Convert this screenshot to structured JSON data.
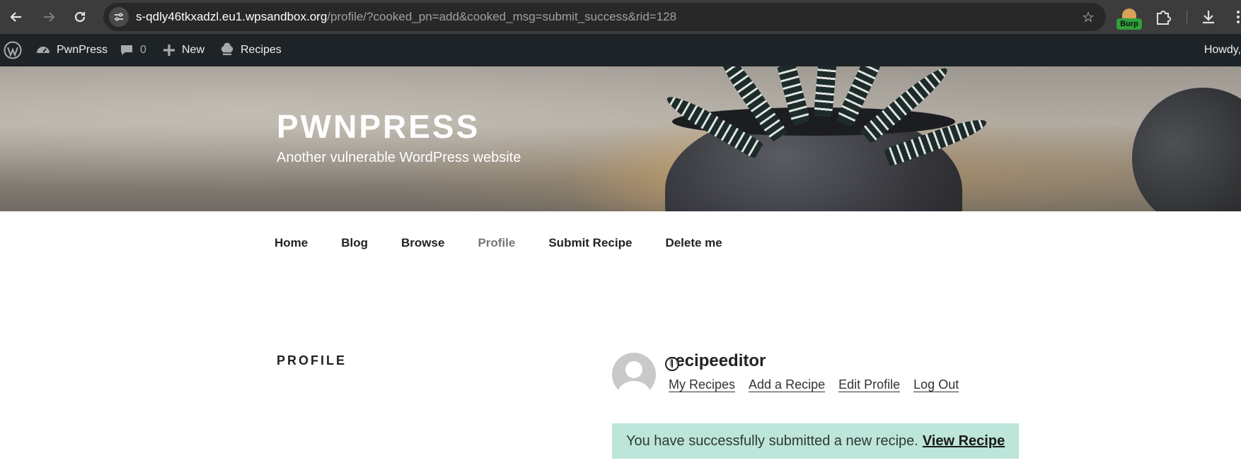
{
  "browser": {
    "url_host": "s-qdly46tkxadzl.eu1.wpsandbox.org",
    "url_rest": "/profile/?cooked_pn=add&cooked_msg=submit_success&rid=128",
    "extension_badge": "Burp",
    "icons": [
      "back-arrow-icon",
      "forward-arrow-icon",
      "reload-icon",
      "site-info-icon",
      "bookmark-star-icon",
      "burp-extension-icon",
      "extensions-puzzle-icon",
      "download-icon"
    ]
  },
  "adminbar": {
    "site_name": "PwnPress",
    "comments_count": "0",
    "new_label": "New",
    "recipes_label": "Recipes",
    "howdy": "Howdy,"
  },
  "header": {
    "site_title": "PWNPRESS",
    "tagline": "Another vulnerable WordPress website"
  },
  "nav": {
    "items": [
      {
        "label": "Home"
      },
      {
        "label": "Blog"
      },
      {
        "label": "Browse"
      },
      {
        "label": "Profile"
      },
      {
        "label": "Submit Recipe"
      },
      {
        "label": "Delete me"
      }
    ],
    "current": "Profile"
  },
  "content": {
    "heading": "PROFILE",
    "username": "recipeeditor",
    "links": [
      {
        "label": "My Recipes"
      },
      {
        "label": "Add a Recipe"
      },
      {
        "label": "Edit Profile"
      },
      {
        "label": "Log Out"
      }
    ],
    "notice": {
      "message": "You have successfully submitted a new recipe.",
      "link_label": "View Recipe"
    }
  },
  "colors": {
    "chrome_bg": "#3c3c3c",
    "adminbar_bg": "#1d2327",
    "notice_bg": "#bde5da"
  }
}
